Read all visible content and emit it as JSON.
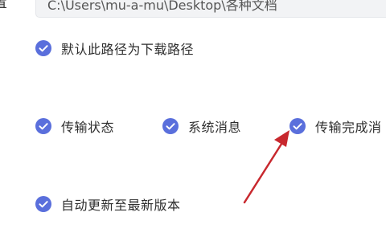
{
  "download_path": {
    "label_fragment": "置",
    "value": "C:\\Users\\mu-a-mu\\Desktop\\各种文档"
  },
  "options": {
    "default_path": {
      "label": "默认此路径为下载路径",
      "checked": true
    },
    "transfer_status": {
      "label": "传输状态",
      "checked": true
    },
    "system_messages": {
      "label": "系统消息",
      "checked": true
    },
    "transfer_complete": {
      "label": "传输完成消",
      "checked": true
    },
    "auto_update": {
      "label": "自动更新至最新版本",
      "checked": true
    }
  },
  "colors": {
    "checkbox": "#5a6fdc",
    "annotation_arrow": "#c8282e"
  }
}
